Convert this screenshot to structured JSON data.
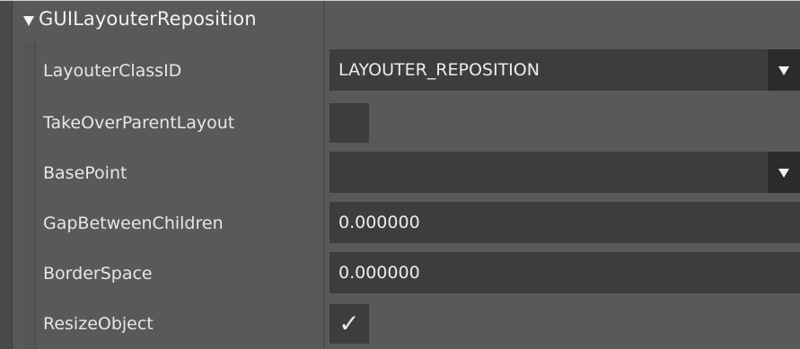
{
  "section": {
    "title": "GUILayouterReposition",
    "expanded": true
  },
  "properties": [
    {
      "label": "LayouterClassID",
      "type": "dropdown",
      "value": "LAYOUTER_REPOSITION"
    },
    {
      "label": "TakeOverParentLayout",
      "type": "checkbox",
      "checked": false
    },
    {
      "label": "BasePoint",
      "type": "dropdown",
      "value": ""
    },
    {
      "label": "GapBetweenChildren",
      "type": "number",
      "value": "0.000000"
    },
    {
      "label": "BorderSpace",
      "type": "number",
      "value": "0.000000"
    },
    {
      "label": "ResizeObject",
      "type": "checkbox",
      "checked": true
    }
  ],
  "icons": {
    "expand": "triangle-down-icon",
    "dropdown": "chevron-down-icon",
    "check": "checkmark-icon"
  },
  "check_glyph": "✓",
  "colors": {
    "background": "#595959",
    "field": "#3d3d3d",
    "dropdown_button": "#2b2b2b",
    "text": "#e6e6e6"
  }
}
